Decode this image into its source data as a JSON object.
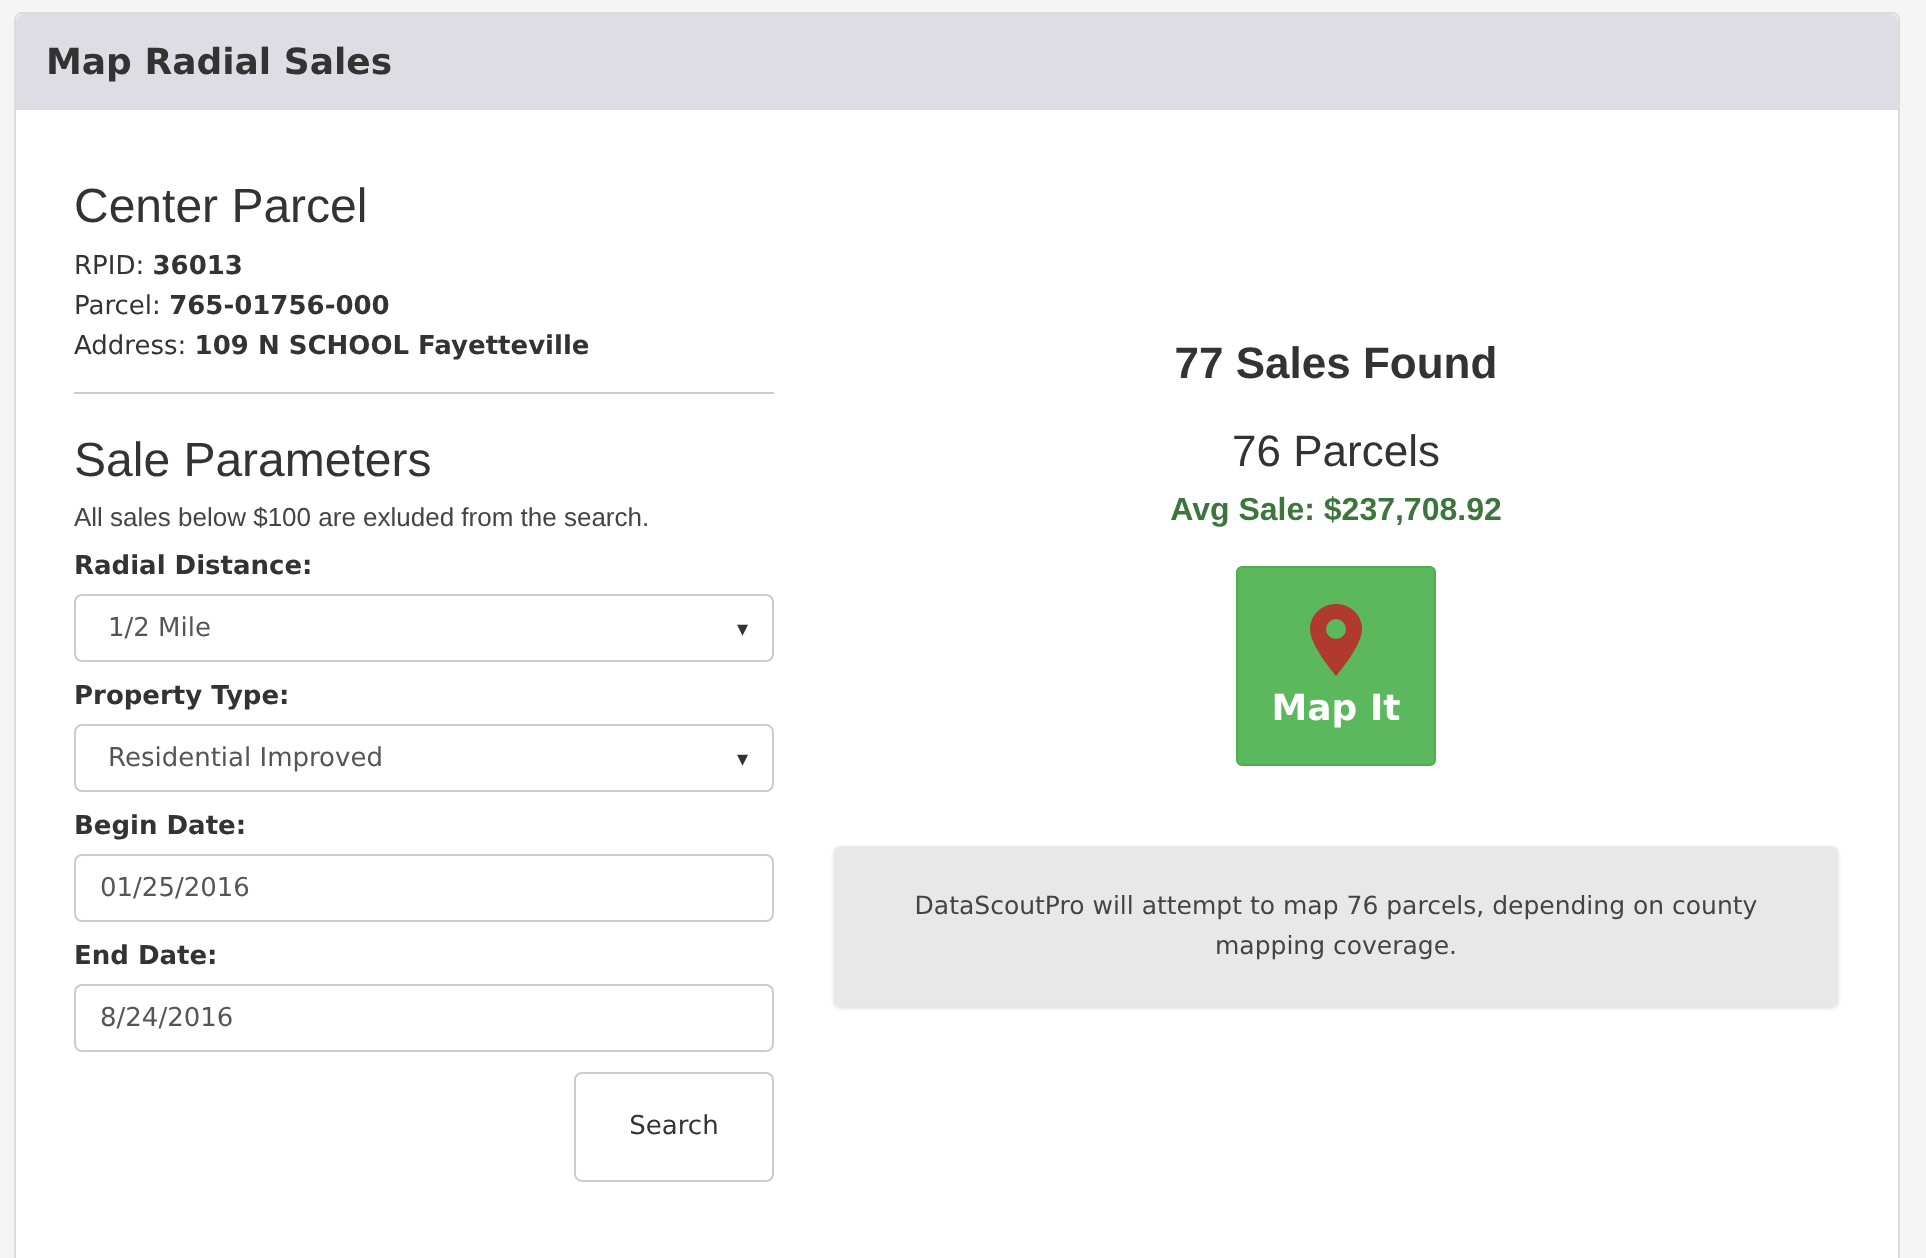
{
  "panel": {
    "title": "Map Radial Sales"
  },
  "center_parcel": {
    "heading": "Center Parcel",
    "lines": [
      "RPID: **36013**",
      "Parcel: **765-01756-000**",
      "Address: **109 N SCHOOL Fayetteville**"
    ]
  },
  "sale_parameters": {
    "heading": "Sale Parameters",
    "note": "All sales below $100 are exluded from the search.",
    "fields": [
      {
        "label": "Radial Distance:",
        "kind": "select",
        "value": "1/2 Mile",
        "caret": "▾"
      },
      {
        "label": "Property Type:",
        "kind": "select",
        "value": "Residential Improved",
        "caret": "▾"
      },
      {
        "label": "Begin Date:",
        "kind": "text",
        "value": "01/25/2016"
      },
      {
        "label": "End Date:",
        "kind": "text",
        "value": "8/24/2016"
      }
    ],
    "search_button": "Search"
  },
  "results": {
    "sales_found": "77 Sales Found",
    "parcels": "76 Parcels",
    "avg_sale": "Avg Sale: $237,708.92",
    "map_button": "Map It",
    "message": "DataScoutPro will attempt to map 76 parcels, depending on county mapping coverage."
  }
}
